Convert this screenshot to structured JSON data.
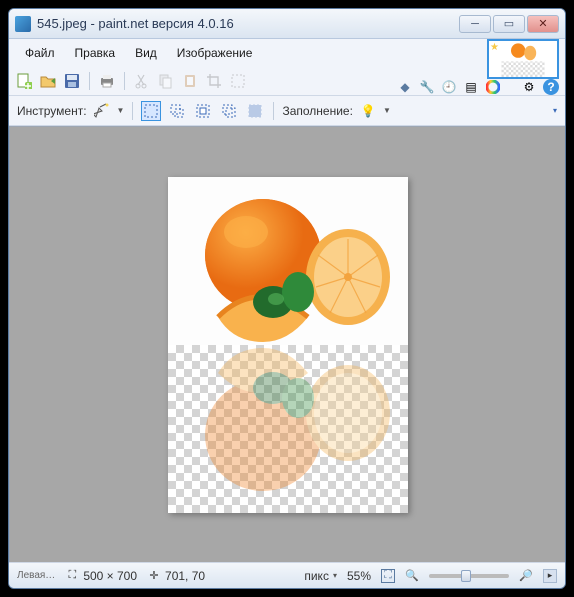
{
  "title": "545.jpeg - paint.net версия 4.0.16",
  "menu": {
    "file": "Файл",
    "edit": "Правка",
    "view": "Вид",
    "image": "Изображение"
  },
  "tool": {
    "label": "Инструмент:",
    "fill": "Заполнение:"
  },
  "status": {
    "corner": "Левая…",
    "dims": "500 × 700",
    "cursor": "701, 70",
    "units": "пикс",
    "zoom": "55%"
  }
}
